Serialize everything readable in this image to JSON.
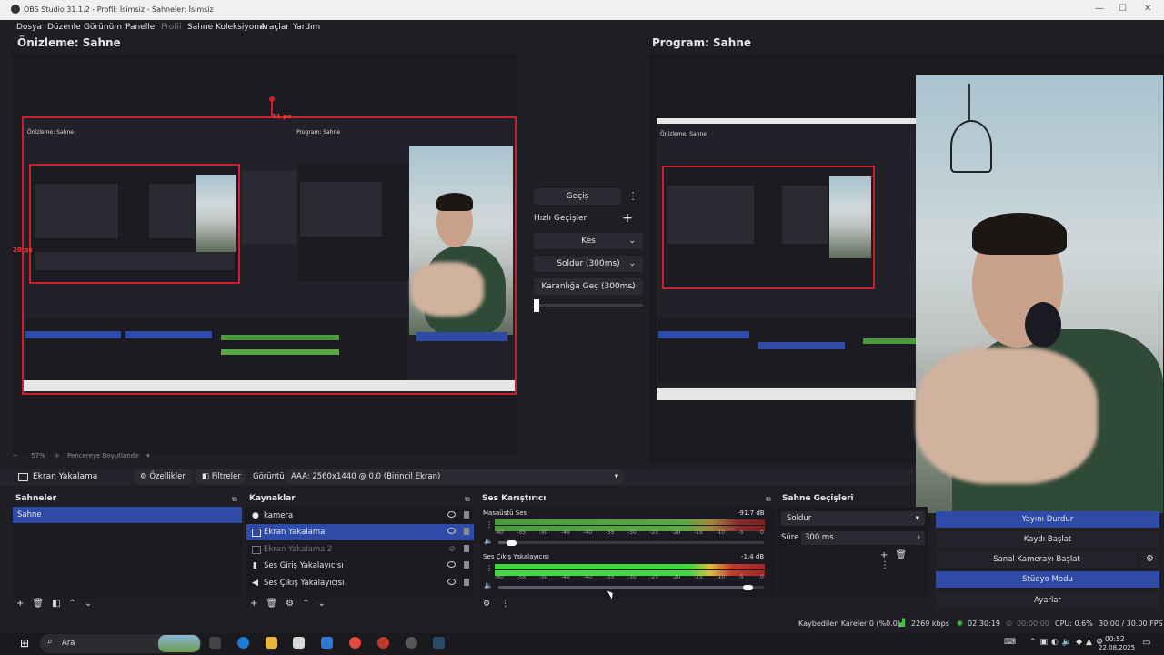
{
  "window": {
    "title": "OBS Studio 31.1.2 - Profil: İsimsiz - Sahneler: İsimsiz"
  },
  "menu": {
    "items": [
      {
        "label": "Dosya",
        "enabled": true
      },
      {
        "label": "Düzenle",
        "enabled": true
      },
      {
        "label": "Görünüm",
        "enabled": true
      },
      {
        "label": "Paneller",
        "enabled": true
      },
      {
        "label": "Profil",
        "enabled": false
      },
      {
        "label": "Sahne Koleksiyonu",
        "enabled": true
      },
      {
        "label": "Araçlar",
        "enabled": true
      },
      {
        "label": "Yardım",
        "enabled": true
      }
    ]
  },
  "preview": {
    "title": "Önizleme: Sahne",
    "size_label_top": "11 px",
    "size_label_left": "20 px",
    "zoom": "57%",
    "fit_label": "Pencereye Boyutlandır"
  },
  "program": {
    "title": "Program: Sahne"
  },
  "transitions": {
    "main": "Geçiş",
    "quick_title": "Hızlı Geçişler",
    "cut": "Kes",
    "fade": "Soldur (300ms)",
    "fade_black": "Karanlığa Geç (300ms)"
  },
  "source_bar": {
    "selected_source": "Ekran Yakalama",
    "properties": "Özellikler",
    "filters": "Filtreler",
    "display_label": "Görüntü",
    "display_value": "AAA: 2560x1440 @ 0,0 (Birincil Ekran)"
  },
  "scenes": {
    "title": "Sahneler",
    "items": [
      "Sahne"
    ]
  },
  "sources": {
    "title": "Kaynaklar",
    "items": [
      {
        "label": "kamera",
        "icon": "camera-icon",
        "visible": true
      },
      {
        "label": "Ekran Yakalama",
        "icon": "monitor-icon",
        "visible": true,
        "selected": true
      },
      {
        "label": "Ekran Yakalama 2",
        "icon": "monitor-icon",
        "visible": false
      },
      {
        "label": "Ses Giriş Yakalayıcısı",
        "icon": "mic-icon",
        "visible": true
      },
      {
        "label": "Ses Çıkış Yakalayıcısı",
        "icon": "speaker-icon",
        "visible": true
      }
    ]
  },
  "mixer": {
    "title": "Ses Karıştırıcı",
    "channels": [
      {
        "name": "Masaüstü Ses",
        "db": "-91.7 dB",
        "volume": 0.07
      },
      {
        "name": "Ses Çıkış Yakalayıcısı",
        "db": "-1.4 dB",
        "volume": 0.96
      }
    ],
    "scale": [
      "-60",
      "-55",
      "-50",
      "-45",
      "-40",
      "-35",
      "-30",
      "-25",
      "-20",
      "-15",
      "-10",
      "-5",
      "0"
    ]
  },
  "scene_transitions": {
    "title": "Sahne Geçişleri",
    "type": "Soldur",
    "duration_label": "Süre",
    "duration_value": "300 ms"
  },
  "controls": {
    "stop_stream": "Yayını Durdur",
    "start_record": "Kaydı Başlat",
    "virtual_cam": "Sanal Kamerayı Başlat",
    "studio_mode": "Stüdyo Modu",
    "settings": "Ayarlar"
  },
  "status": {
    "dropped": "Kaybedilen Kareler 0 (%0.0)",
    "bitrate": "2269 kbps",
    "stream_time": "02:30:19",
    "record_time": "00:00:00",
    "cpu": "CPU: 0.6%",
    "fps": "30.00 / 30.00 FPS"
  },
  "taskbar": {
    "search": "Ara",
    "time": "00:52",
    "date": "22.08.2025"
  },
  "colors": {
    "accent": "#2f4ba8",
    "red": "#d01e2b",
    "bg": "#1f1e25"
  }
}
